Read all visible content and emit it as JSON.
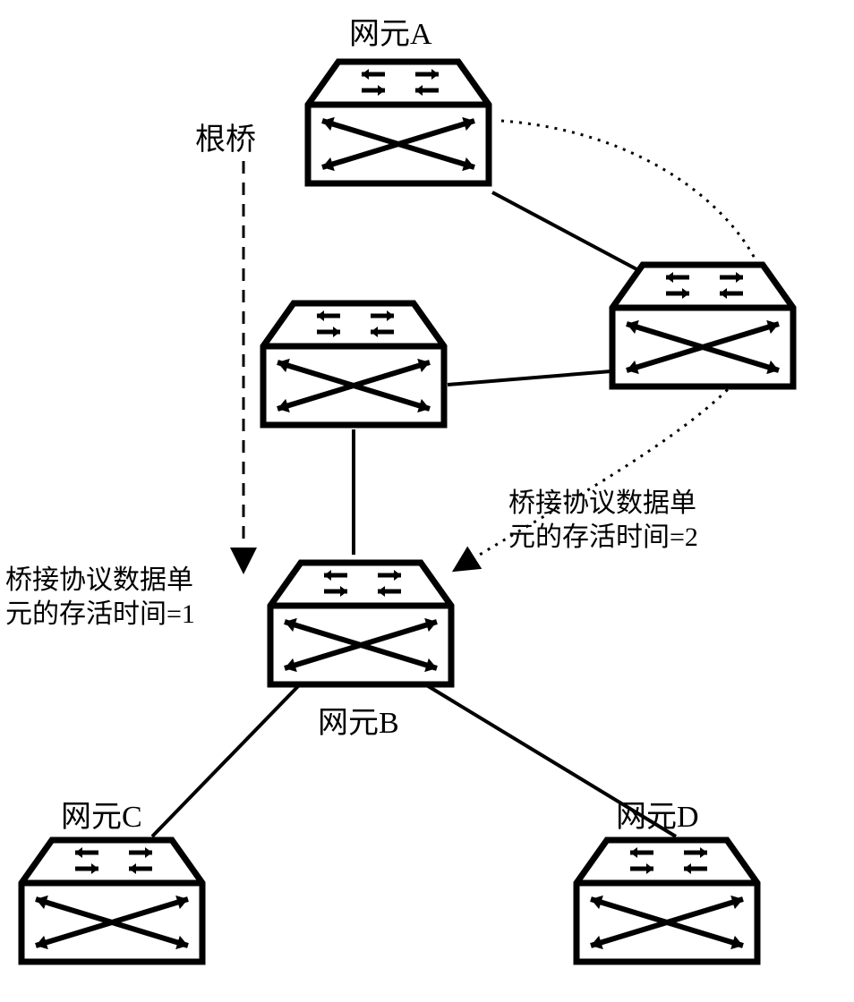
{
  "labels": {
    "node_a": "网元A",
    "root_bridge": "根桥",
    "node_b": "网元B",
    "node_c": "网元C",
    "node_d": "网元D"
  },
  "annotations": {
    "left_msg_line1": "桥接协议数据单",
    "left_msg_line2": "元的存活时间=1",
    "right_msg_line1": "桥接协议数据单",
    "right_msg_line2": "元的存活时间=2"
  },
  "diagram_data": {
    "description": "Spanning-tree style topology with five network-element (switch) nodes. 网元A is the root bridge. Two intermediate unnamed switches sit between 网元A and 网元B. 网元B branches to 网元C and 网元D. Two annotated paths show Bridge Protocol Data Unit (BPDU) survival time (message age) along alternate paths from root bridge 网元A down to 网元B: the left (short) dashed path has survival time = 1, the right (dotted, longer) path via the right-side switch has survival time = 2.",
    "nodes": [
      {
        "id": "A",
        "label_key": "node_a",
        "role": "root_bridge"
      },
      {
        "id": "mid_left",
        "label_key": null,
        "role": "switch"
      },
      {
        "id": "mid_right",
        "label_key": null,
        "role": "switch"
      },
      {
        "id": "B",
        "label_key": "node_b",
        "role": "switch"
      },
      {
        "id": "C",
        "label_key": "node_c",
        "role": "switch"
      },
      {
        "id": "D",
        "label_key": "node_d",
        "role": "switch"
      }
    ],
    "solid_links": [
      [
        "A",
        "mid_right"
      ],
      [
        "mid_left",
        "mid_right"
      ],
      [
        "mid_left",
        "B"
      ],
      [
        "B",
        "C"
      ],
      [
        "B",
        "D"
      ]
    ],
    "dashed_path": {
      "from": "A",
      "to": "B",
      "bpdu_survival_time": 1
    },
    "dotted_path": {
      "from": "A",
      "via": "mid_right",
      "to": "B",
      "bpdu_survival_time": 2
    }
  }
}
